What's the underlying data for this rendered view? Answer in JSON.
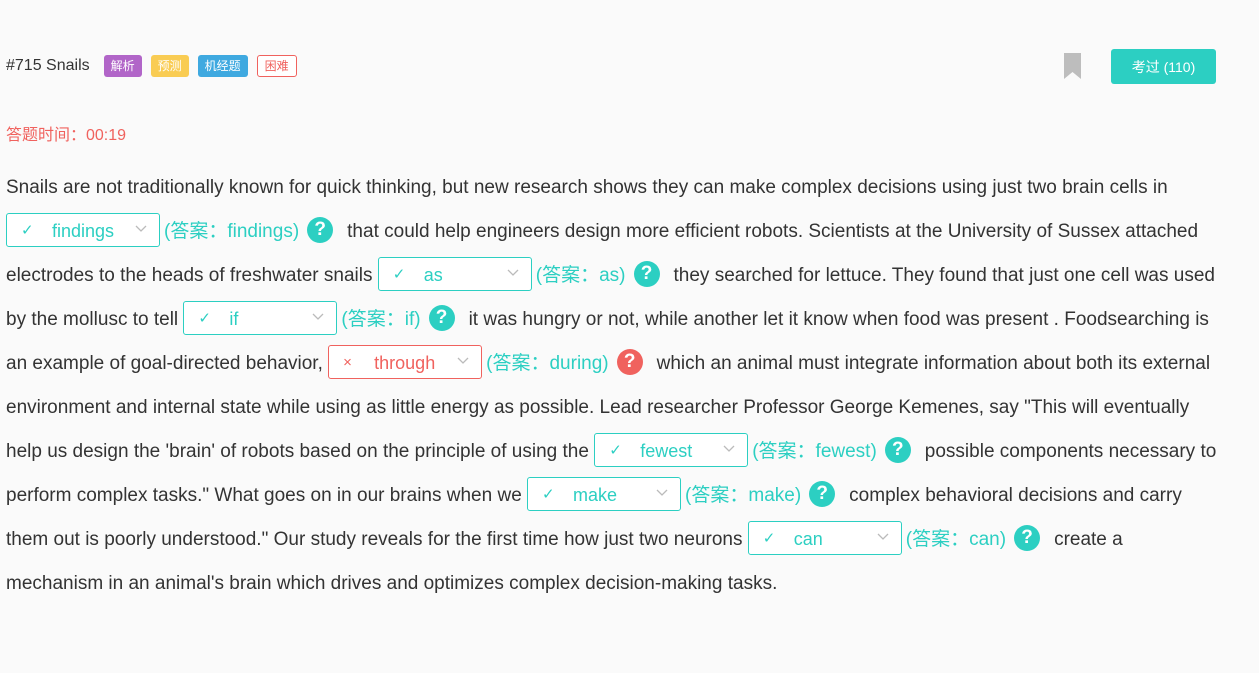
{
  "header": {
    "question_title": "#715 Snails",
    "tags": [
      "解析",
      "预测",
      "机经题",
      "困难"
    ],
    "exam_button_label": "考过 (110)"
  },
  "timer_text": "答题时间：00:19",
  "passage": {
    "seg0": "Snails are not traditionally known for quick thinking, but new research shows they can make complex decisions using just two brain cells in",
    "seg1": "that could help engineers design more efficient robots. Scientists at the University of Sussex attached electrodes to the heads of freshwater snails",
    "seg2": "they searched for lettuce. They found that just one cell was used by the mollusc to tell",
    "seg3": "it was hungry or not, while another let it know when food was present . Foodsearching is an example of goal-directed behavior,",
    "seg4": "which an animal must integrate information about both its external environment and internal state while using as little energy as possible. Lead researcher Professor George Kemenes, say \"This will eventually help us design the 'brain' of robots based on the principle of using the",
    "seg5": "possible components necessary to perform complex tasks.\" What goes on in our brains when we",
    "seg6": "complex behavioral decisions and carry them out is poorly understood.\" Our study reveals for the first time how just two neurons",
    "seg7": "create a mechanism in an animal's brain which drives and optimizes complex decision-making tasks."
  },
  "blanks": [
    {
      "selected": "findings",
      "answer": "(答案：findings)",
      "mark": "✓",
      "help": "?"
    },
    {
      "selected": "as",
      "answer": "(答案：as)",
      "mark": "✓",
      "help": "?"
    },
    {
      "selected": "if",
      "answer": "(答案：if)",
      "mark": "✓",
      "help": "?"
    },
    {
      "selected": "through",
      "answer": "(答案：during)",
      "mark": "×",
      "help": "?"
    },
    {
      "selected": "fewest",
      "answer": "(答案：fewest)",
      "mark": "✓",
      "help": "?"
    },
    {
      "selected": "make",
      "answer": "(答案：make)",
      "mark": "✓",
      "help": "?"
    },
    {
      "selected": "can",
      "answer": "(答案：can)",
      "mark": "✓",
      "help": "?"
    }
  ],
  "icons": {
    "bookmark": "bookmark-icon",
    "chevron": "chevron-down-icon",
    "help": "help-circle-icon",
    "correct": "check-icon",
    "wrong": "cross-icon"
  },
  "colors": {
    "accent": "#2ccfc2",
    "error": "#f0625e",
    "tag_purple": "#b165c8",
    "tag_yellow": "#f9cc53",
    "tag_blue": "#3fa9e0",
    "bookmark": "#bdbdbd"
  }
}
